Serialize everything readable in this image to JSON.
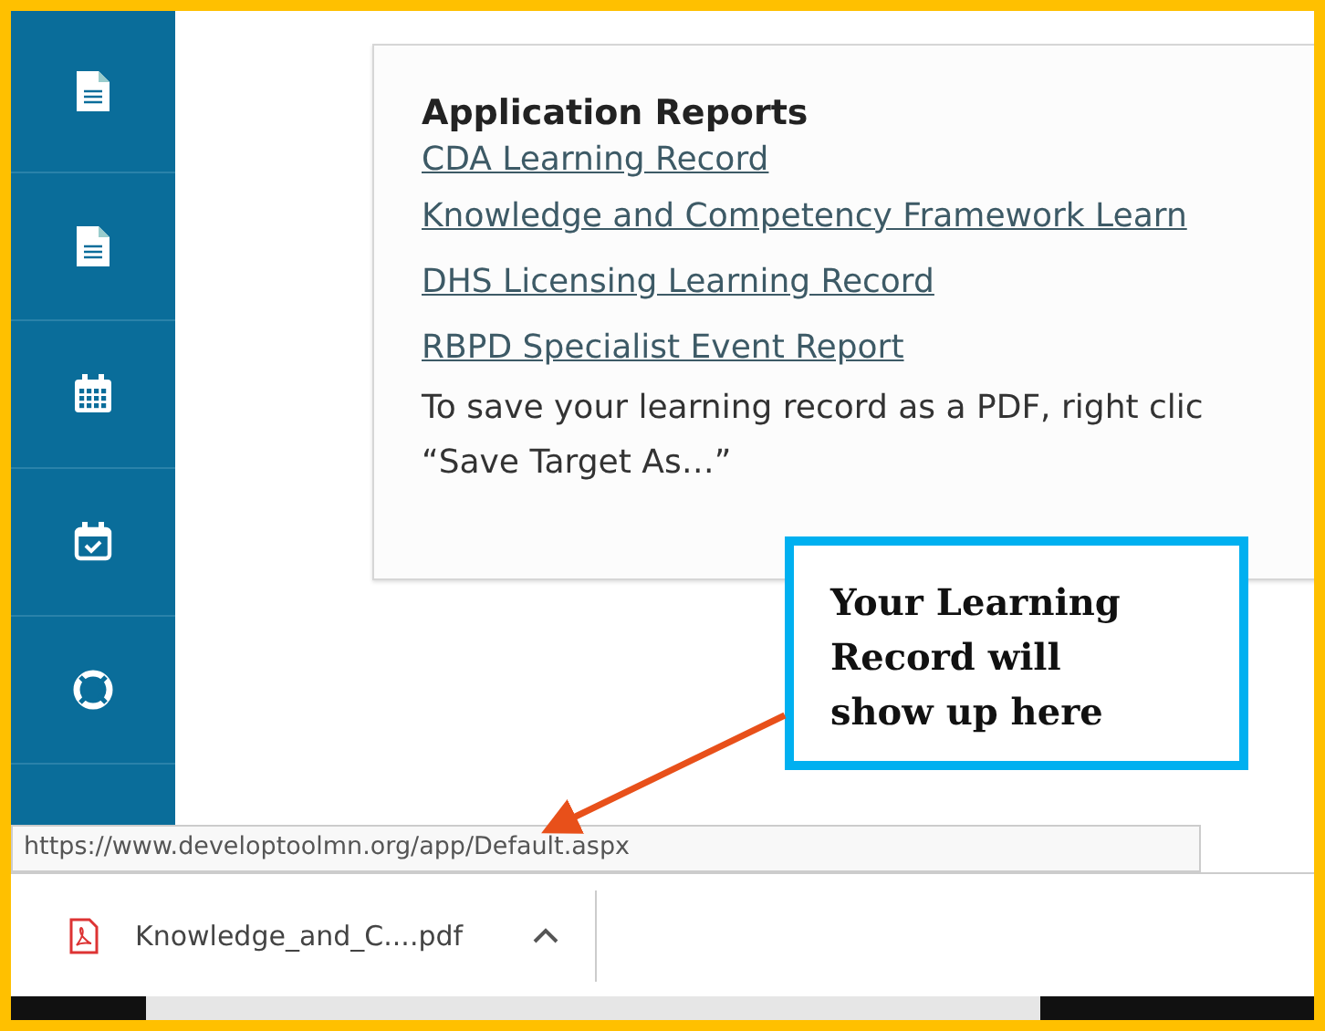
{
  "sidebar": {
    "items": [
      {
        "kind": "document"
      },
      {
        "kind": "document"
      },
      {
        "kind": "calendar"
      },
      {
        "kind": "calendar-check"
      },
      {
        "kind": "lifebuoy"
      }
    ]
  },
  "reports": {
    "title": "Application Reports",
    "links": [
      "CDA Learning Record",
      "Knowledge and Competency Framework Learn",
      "DHS Licensing Learning Record",
      "RBPD Specialist Event Report"
    ],
    "note_lines": [
      "To save your learning record as a PDF, right clic",
      "“Save Target As…”"
    ]
  },
  "callout": {
    "text": "Your Learning Record will show up here"
  },
  "status_url": "https://www.developtoolmn.org/app/Default.aspx",
  "download": {
    "filename": "Knowledge_and_C....pdf"
  }
}
